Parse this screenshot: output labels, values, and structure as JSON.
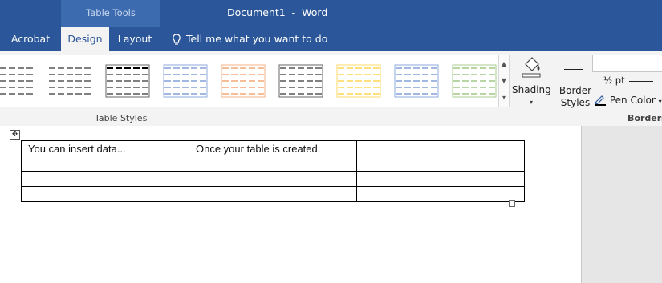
{
  "title_bar": {
    "context_tab": "Table Tools",
    "document": "Document1",
    "separator": "-",
    "app": "Word"
  },
  "tabs": [
    {
      "label": "Acrobat",
      "active": false
    },
    {
      "label": "Design",
      "active": true
    },
    {
      "label": "Layout",
      "active": false
    }
  ],
  "tell_me": "Tell me what you want to do",
  "ribbon": {
    "table_styles_label": "Table Styles",
    "shading_label": "Shading",
    "border_styles_label": "Border Styles",
    "pen_weight": "½ pt",
    "pen_color_label": "Pen Color",
    "borders_group_label": "Borders",
    "style_colors": [
      "#000000",
      "#000000",
      "#000000",
      "#4472c4",
      "#ed7d31",
      "#000000",
      "#ffc000",
      "#4472c4",
      "#70ad47"
    ]
  },
  "table": {
    "rows": [
      [
        "You can insert data...",
        "Once your table is created.",
        ""
      ],
      [
        "",
        "",
        ""
      ],
      [
        "",
        "",
        ""
      ],
      [
        "",
        "",
        ""
      ]
    ]
  }
}
